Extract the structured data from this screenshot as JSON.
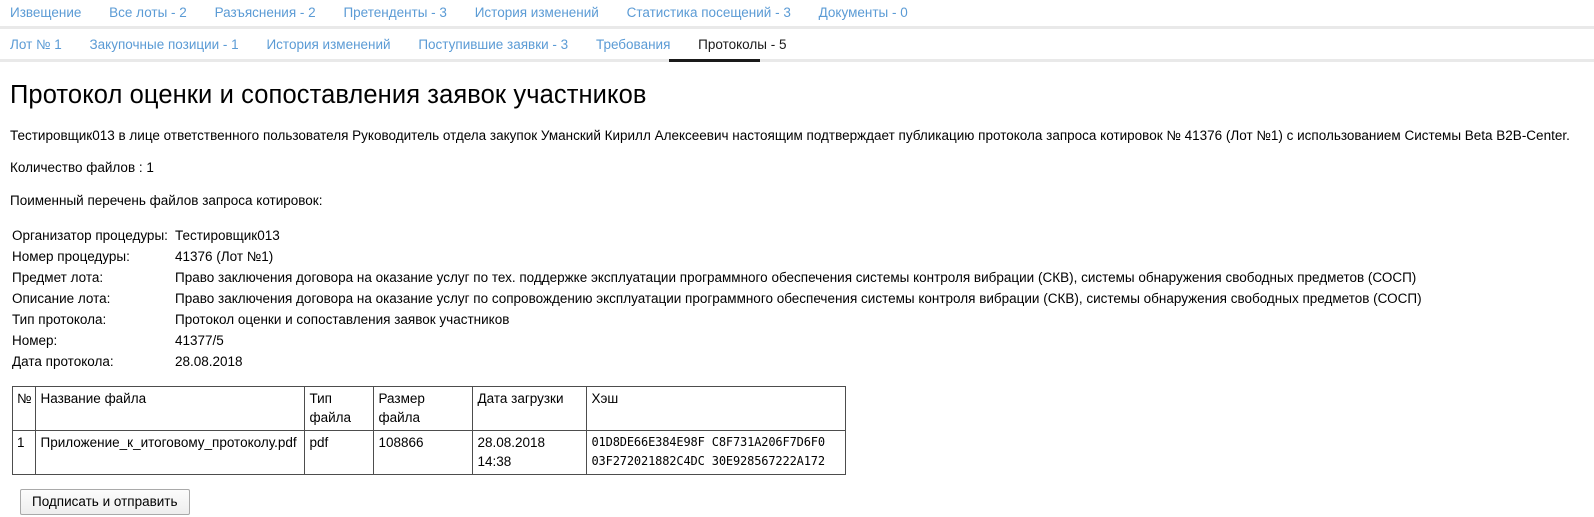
{
  "nav_primary": {
    "items": [
      {
        "label": "Извещение"
      },
      {
        "label": "Все лоты - 2"
      },
      {
        "label": "Разъяснения - 2"
      },
      {
        "label": "Претенденты - 3"
      },
      {
        "label": "История изменений"
      },
      {
        "label": "Статистика посещений - 3"
      },
      {
        "label": "Документы - 0"
      }
    ]
  },
  "nav_secondary": {
    "items": [
      {
        "label": "Лот № 1",
        "active": false
      },
      {
        "label": "Закупочные позиции - 1",
        "active": false
      },
      {
        "label": "История изменений",
        "active": false
      },
      {
        "label": "Поступившие заявки - 3",
        "active": false
      },
      {
        "label": "Требования",
        "active": false
      },
      {
        "label": "Протоколы - 5",
        "active": true
      }
    ]
  },
  "main": {
    "title": "Протокол оценки и сопоставления заявок участников",
    "intro": "Тестировщик013 в лице ответственного пользователя Руководитель отдела закупок Уманский Кирилл Алексеевич настоящим подтверждает публикацию протокола запроса котировок № 41376 (Лот №1) с использованием Системы Beta B2B-Center.",
    "files_count_text": "Количество файлов : 1",
    "files_list_title": "Поименный перечень файлов запроса котировок:",
    "details": [
      {
        "label": "Организатор процедуры:",
        "value": "Тестировщик013"
      },
      {
        "label": "Номер процедуры:",
        "value": "41376 (Лот №1)"
      },
      {
        "label": "Предмет лота:",
        "value": "Право заключения договора на оказание услуг по тех. поддержке эксплуатации программного обеспечения системы контроля вибрации (СКВ), системы обнаружения свободных предметов (СОСП)"
      },
      {
        "label": "Описание лота:",
        "value": "Право заключения договора на оказание услуг по сопровождению эксплуатации программного обеспечения системы контроля вибрации (СКВ), системы обнаружения свободных предметов (СОСП)"
      },
      {
        "label": "Тип протокола:",
        "value": "Протокол оценки и сопоставления заявок участников"
      },
      {
        "label": "Номер:",
        "value": "41377/5"
      },
      {
        "label": "Дата протокола:",
        "value": "28.08.2018"
      }
    ],
    "table": {
      "headers": [
        "№",
        "Название файла",
        "Тип файла",
        "Размер файла",
        "Дата загрузки",
        "Хэш"
      ],
      "rows": [
        {
          "num": "1",
          "name": "Приложение_к_итоговому_протоколу.pdf",
          "type": "pdf",
          "size": "108866",
          "date": "28.08.2018 14:38",
          "hash": "01D8DE66E384E98F C8F731A206F7D6F0\n03F272021882C4DC 30E928567222A172"
        }
      ]
    },
    "submit_label": "Подписать и отправить"
  },
  "colors": {
    "link": "#5b9bd5",
    "active_tab": "#1a1a1a",
    "divider": "#e9e9e9",
    "table_border": "#4d4d4d"
  }
}
